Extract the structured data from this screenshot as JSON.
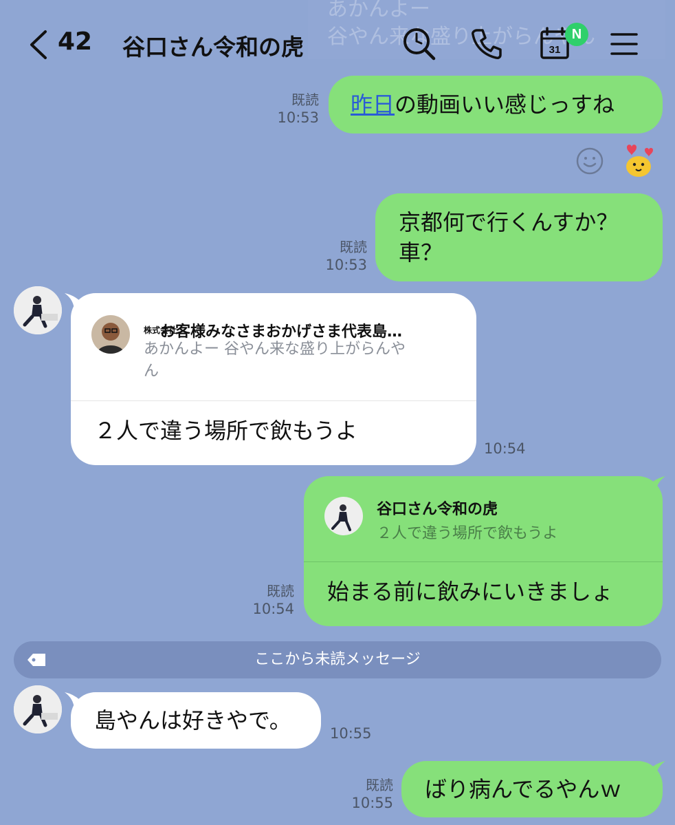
{
  "ghost_text": {
    "line1": "あかんよー",
    "line2": "谷やん来な盛り上がらんやん"
  },
  "header": {
    "back_count": "42",
    "title": "谷口さん令和の虎",
    "badge": "N",
    "calendar_day": "31"
  },
  "messages": [
    {
      "id": "m1",
      "side": "right",
      "read": "既読",
      "time": "10:53",
      "link_text": "昨日",
      "text": "の動画いい感じっすね"
    },
    {
      "id": "m2",
      "side": "right",
      "read": "既読",
      "time": "10:53",
      "line1": "京都何で行くんすか？",
      "line2": "車？"
    },
    {
      "id": "m3",
      "side": "left",
      "time": "10:54",
      "reply": {
        "name_prefix": "株式会社",
        "name": "お客様みなさまおかげさま代表島…",
        "line1": "あかんよー 谷やん来な盛り上がらんや",
        "line2": "ん"
      },
      "text": "２人で違う場所で飲もうよ"
    },
    {
      "id": "m4",
      "side": "right",
      "read": "既読",
      "time": "10:54",
      "reply": {
        "name": "谷口さん令和の虎",
        "text": "２人で違う場所で飲もうよ"
      },
      "text": "始まる前に飲みにいきましょ"
    },
    {
      "id": "m5",
      "side": "left",
      "time": "10:55",
      "text": "島やんは好きやで。"
    },
    {
      "id": "m6",
      "side": "right",
      "read": "既読",
      "time": "10:55",
      "text": "ばり病んでるやんｗ"
    }
  ],
  "unread_bar": {
    "label": "ここから未読メッセージ"
  },
  "colors": {
    "background": "#8fa6d3",
    "green_bubble": "#86e07a",
    "white_bubble": "#ffffff",
    "badge": "#2fd06b",
    "unread_bar": "#7a8fbe"
  }
}
